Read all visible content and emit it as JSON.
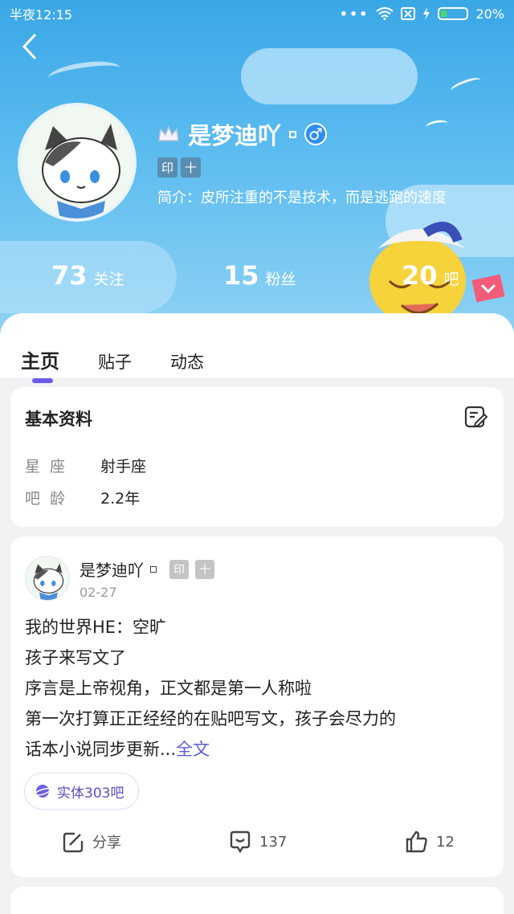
{
  "status_bar": {
    "time": "半夜12:15",
    "dots": "•••",
    "battery": "20%"
  },
  "profile": {
    "name": "是梦迪吖",
    "gender_symbol": "♂",
    "badges": [
      "印",
      "十"
    ],
    "bio": "简介：皮所注重的不是技术，而是逃跑的速度",
    "stats": [
      {
        "num": "73",
        "label": "关注"
      },
      {
        "num": "15",
        "label": "粉丝"
      },
      {
        "num": "20",
        "label": "吧"
      }
    ]
  },
  "tabs": [
    {
      "label": "主页",
      "active": true
    },
    {
      "label": "贴子",
      "active": false
    },
    {
      "label": "动态",
      "active": false
    }
  ],
  "basic_info": {
    "title": "基本资料",
    "rows": [
      {
        "key": "星座",
        "value": "射手座"
      },
      {
        "key": "吧龄",
        "value": "2.2年"
      }
    ]
  },
  "post": {
    "author": "是梦迪吖",
    "badges": [
      "印",
      "十"
    ],
    "date": "02-27",
    "lines": [
      "我的世界HE：空旷",
      "孩子来写文了",
      "序言是上帝视角，正文都是第一人称啦",
      "第一次打算正正经经的在贴吧写文，孩子会尽力的",
      "话本小说同步更新..."
    ],
    "more_link": "全文",
    "tag": "实体303吧",
    "actions": {
      "share": "分享",
      "comments": "137",
      "likes": "12"
    }
  },
  "colors": {
    "accent": "#6b5ce7",
    "link": "#5b5bd6",
    "header": "#3aa7e6"
  }
}
